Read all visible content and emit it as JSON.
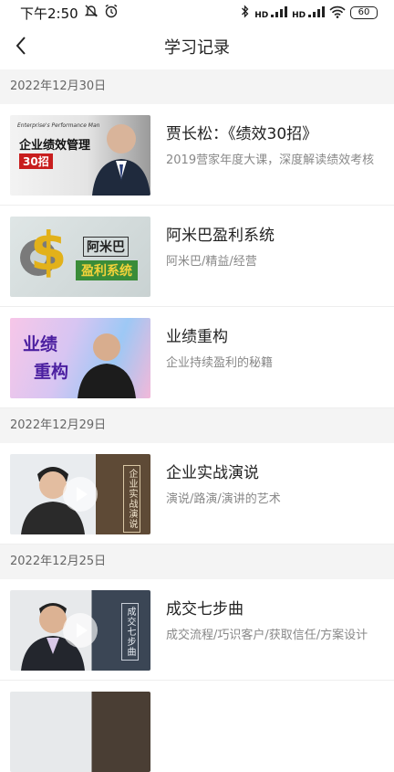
{
  "status_bar": {
    "time": "下午2:50",
    "icons": [
      "silent-bell-icon",
      "alarm-icon",
      "bluetooth-icon",
      "signal-hd-icon",
      "signal-hd-icon",
      "wifi-icon"
    ],
    "network_labels": [
      "HD",
      "HD"
    ],
    "battery": "60"
  },
  "nav": {
    "title": "学习记录",
    "back_icon": "back-arrow-icon"
  },
  "sections": [
    {
      "date": "2022年12月30日",
      "items": [
        {
          "title": "贾长松：《绩效30招》",
          "desc": "2019营家年度大课，深度解读绩效考核",
          "thumb": {
            "top": "Enterprise's Performance Management",
            "main": "企业绩效管理",
            "sub": "30招"
          }
        },
        {
          "title": "阿米巴盈利系统",
          "desc": "阿米巴/精益/经营",
          "thumb": {
            "main": "阿米巴",
            "sub": "盈利系统"
          }
        },
        {
          "title": "业绩重构",
          "desc": "企业持续盈利的秘籍",
          "thumb": {
            "main": "业绩",
            "sub": "重构"
          }
        }
      ]
    },
    {
      "date": "2022年12月29日",
      "items": [
        {
          "title": "企业实战演说",
          "desc": "演说/路演/演讲的艺术",
          "thumb": {
            "vertical": "企业实战演说"
          }
        }
      ]
    },
    {
      "date": "2022年12月25日",
      "items": [
        {
          "title": "成交七步曲",
          "desc": "成交流程/巧识客户/获取信任/方案设计",
          "thumb": {
            "vertical": "成交七步曲"
          }
        }
      ]
    }
  ],
  "colors": {
    "header_bg": "#f4f4f4",
    "title": "#222222",
    "desc": "#888888",
    "date": "#666666"
  }
}
